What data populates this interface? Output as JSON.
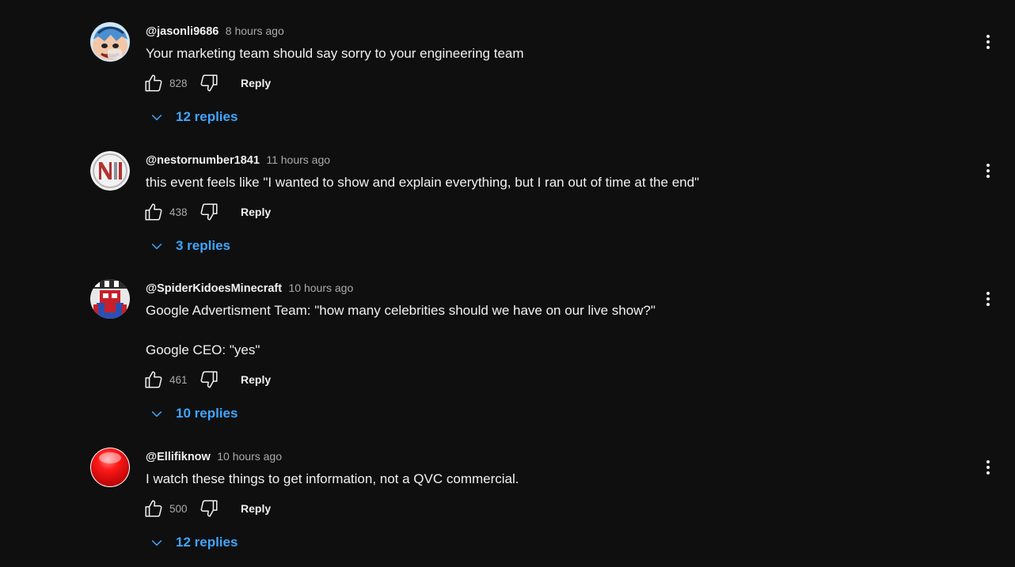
{
  "comments": [
    {
      "author": "@jasonli9686",
      "time": "8 hours ago",
      "text": [
        "Your marketing team should say sorry to your engineering team"
      ],
      "likes": "828",
      "reply_label": "Reply",
      "replies_label": "12 replies",
      "avatar_icon": "cartoon-avatar-icon"
    },
    {
      "author": "@nestornumber1841",
      "time": "11 hours ago",
      "text": [
        "this event feels like \"I wanted to show and explain everything, but I ran out of time at the end\""
      ],
      "likes": "438",
      "reply_label": "Reply",
      "replies_label": "3 replies",
      "avatar_icon": "ni-logo-avatar-icon"
    },
    {
      "author": "@SpiderKidoesMinecraft",
      "time": "10 hours ago",
      "text": [
        "Google Advertisment Team: \"how many celebrities should we have on our live show?\"",
        "Google CEO: \"yes\""
      ],
      "likes": "461",
      "reply_label": "Reply",
      "replies_label": "10 replies",
      "avatar_icon": "spiderman-avatar-icon"
    },
    {
      "author": "@Ellifiknow",
      "time": "10 hours ago",
      "text": [
        "I watch these things to get information, not a QVC commercial."
      ],
      "likes": "500",
      "reply_label": "Reply",
      "replies_label": "12 replies",
      "avatar_icon": "red-ball-avatar-icon"
    }
  ],
  "colors": {
    "background": "#0f0f0f",
    "text": "#f1f1f1",
    "secondary_text": "#aaaaaa",
    "link": "#3ea6ff"
  }
}
